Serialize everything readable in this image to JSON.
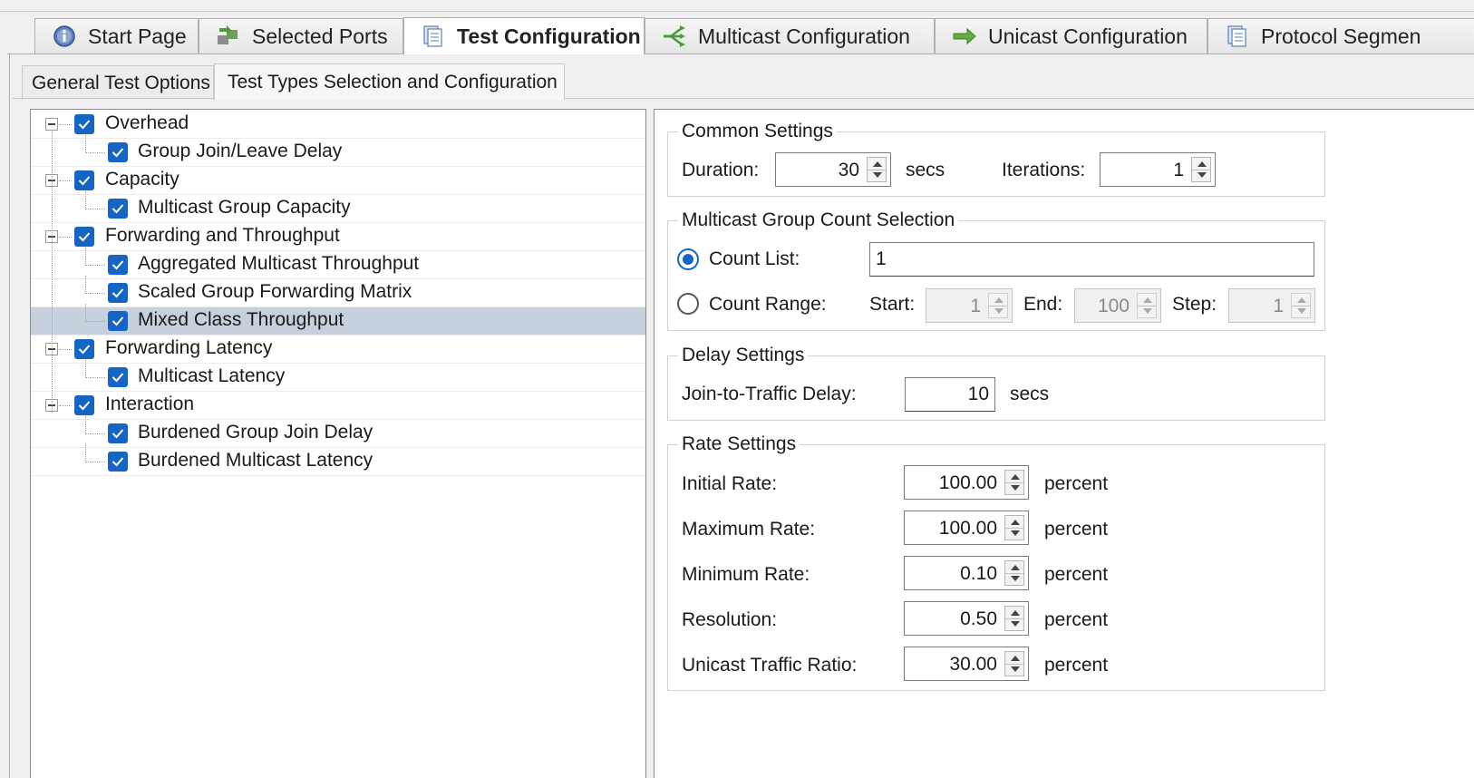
{
  "main_tabs": [
    {
      "label": "Start Page",
      "icon": "info-icon"
    },
    {
      "label": "Selected Ports",
      "icon": "ports-icon"
    },
    {
      "label": "Test Configuration",
      "icon": "document-icon",
      "active": true
    },
    {
      "label": "Multicast Configuration",
      "icon": "multicast-icon"
    },
    {
      "label": "Unicast Configuration",
      "icon": "arrow-right-icon"
    },
    {
      "label": "Protocol Segmen",
      "icon": "document-icon"
    }
  ],
  "sub_tabs": [
    {
      "label": "General Test Options"
    },
    {
      "label": "Test Types Selection and Configuration",
      "active": true
    }
  ],
  "tree": [
    {
      "label": "Overhead",
      "level": 0,
      "checked": true
    },
    {
      "label": "Group Join/Leave Delay",
      "level": 1,
      "checked": true
    },
    {
      "label": "Capacity",
      "level": 0,
      "checked": true
    },
    {
      "label": "Multicast Group Capacity",
      "level": 1,
      "checked": true
    },
    {
      "label": "Forwarding and Throughput",
      "level": 0,
      "checked": true
    },
    {
      "label": "Aggregated Multicast Throughput",
      "level": 1,
      "checked": true
    },
    {
      "label": "Scaled Group Forwarding Matrix",
      "level": 1,
      "checked": true
    },
    {
      "label": "Mixed Class Throughput",
      "level": 1,
      "checked": true,
      "selected": true
    },
    {
      "label": "Forwarding Latency",
      "level": 0,
      "checked": true
    },
    {
      "label": "Multicast Latency",
      "level": 1,
      "checked": true
    },
    {
      "label": "Interaction",
      "level": 0,
      "checked": true
    },
    {
      "label": "Burdened Group Join Delay",
      "level": 1,
      "checked": true
    },
    {
      "label": "Burdened Multicast Latency",
      "level": 1,
      "checked": true
    }
  ],
  "common": {
    "title": "Common Settings",
    "duration_label": "Duration:",
    "duration_value": "30",
    "duration_unit": "secs",
    "iterations_label": "Iterations:",
    "iterations_value": "1"
  },
  "multicast": {
    "title": "Multicast Group Count Selection",
    "count_list_label": "Count List:",
    "count_list_value": "1",
    "count_range_label": "Count Range:",
    "start_label": "Start:",
    "start_value": "1",
    "end_label": "End:",
    "end_value": "100",
    "step_label": "Step:",
    "step_value": "1",
    "selected": "count_list"
  },
  "delay": {
    "title": "Delay Settings",
    "join_label": "Join-to-Traffic Delay:",
    "join_value": "10",
    "join_unit": "secs"
  },
  "rate": {
    "title": "Rate Settings",
    "unit": "percent",
    "rows": [
      {
        "label": "Initial Rate:",
        "value": "100.00"
      },
      {
        "label": "Maximum Rate:",
        "value": "100.00"
      },
      {
        "label": "Minimum Rate:",
        "value": "0.10"
      },
      {
        "label": "Resolution:",
        "value": "0.50"
      },
      {
        "label": "Unicast Traffic Ratio:",
        "value": "30.00"
      }
    ]
  },
  "colors": {
    "accent": "#1565c6",
    "selection": "#c7d0dd"
  }
}
